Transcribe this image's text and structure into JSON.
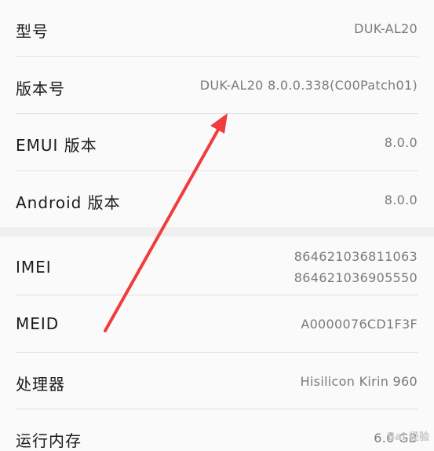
{
  "rows": [
    {
      "label": "型号",
      "value": "DUK-AL20"
    },
    {
      "label": "版本号",
      "value": "DUK-AL20 8.0.0.338(C00Patch01)"
    },
    {
      "label": "EMUI 版本",
      "value": "8.0.0"
    },
    {
      "label": "Android 版本",
      "value": "8.0.0"
    },
    {
      "label": "IMEI",
      "value_line1": "864621036811063",
      "value_line2": "864621036905550"
    },
    {
      "label": "MEID",
      "value": "A0000076CD1F3F"
    },
    {
      "label": "处理器",
      "value": "Hisilicon Kirin 960"
    },
    {
      "label": "运行内存",
      "value": "6.0 GB"
    }
  ],
  "annotation": {
    "arrow_color": "#f03c3c",
    "arrow_icon": "red-arrow-annotation"
  },
  "watermark": {
    "text": "Bai 经验"
  }
}
